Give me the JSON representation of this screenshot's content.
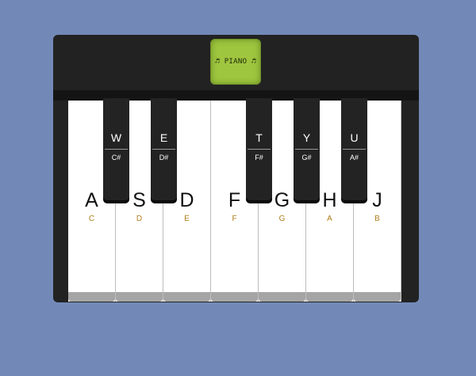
{
  "display": {
    "label": "♬ PIANO ♬"
  },
  "white_keys": [
    {
      "key": "A",
      "note": "C"
    },
    {
      "key": "S",
      "note": "D"
    },
    {
      "key": "D",
      "note": "E"
    },
    {
      "key": "F",
      "note": "F"
    },
    {
      "key": "G",
      "note": "G"
    },
    {
      "key": "H",
      "note": "A"
    },
    {
      "key": "J",
      "note": "B"
    }
  ],
  "black_keys": [
    {
      "key": "W",
      "note": "C#"
    },
    {
      "key": "E",
      "note": "D#"
    },
    {
      "key": "T",
      "note": "F#"
    },
    {
      "key": "Y",
      "note": "G#"
    },
    {
      "key": "U",
      "note": "A#"
    }
  ],
  "colors": {
    "background": "#7289b8",
    "piano_body": "#222222",
    "display": "#9fc63f",
    "note_label": "#b07d1a"
  }
}
